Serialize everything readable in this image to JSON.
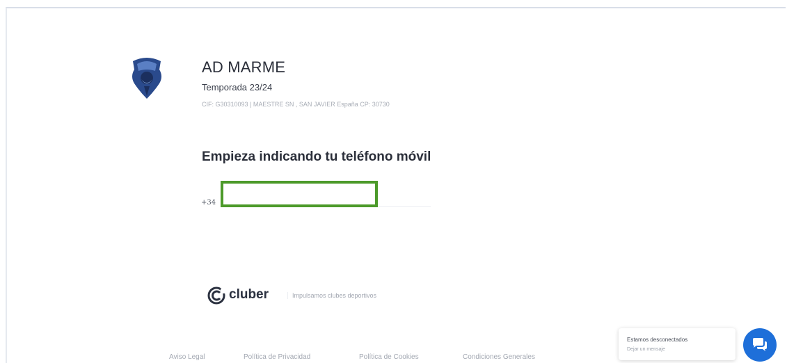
{
  "club": {
    "name": "AD MARME",
    "season": "Temporada 23/24",
    "info": "CIF: G30310093 | MAESTRE SN , SAN JAVIER España CP: 30730"
  },
  "phone": {
    "prompt": "Empieza indicando tu teléfono móvil",
    "prefix": "+34",
    "value": "",
    "highlight_color": "#4c9a2a"
  },
  "brand": {
    "name": "cluber",
    "tagline": "Impulsamos clubes deportivos",
    "color": "#2b3140"
  },
  "footer": {
    "links": [
      "Aviso Legal",
      "Política de Privacidad",
      "Política de Cookies",
      "Condiciones Generales"
    ]
  },
  "chat": {
    "title": "Estamos desconectados",
    "subtitle": "Dejar un mensaje",
    "button_color": "#1e6fd9",
    "icon": "chat-icon"
  }
}
